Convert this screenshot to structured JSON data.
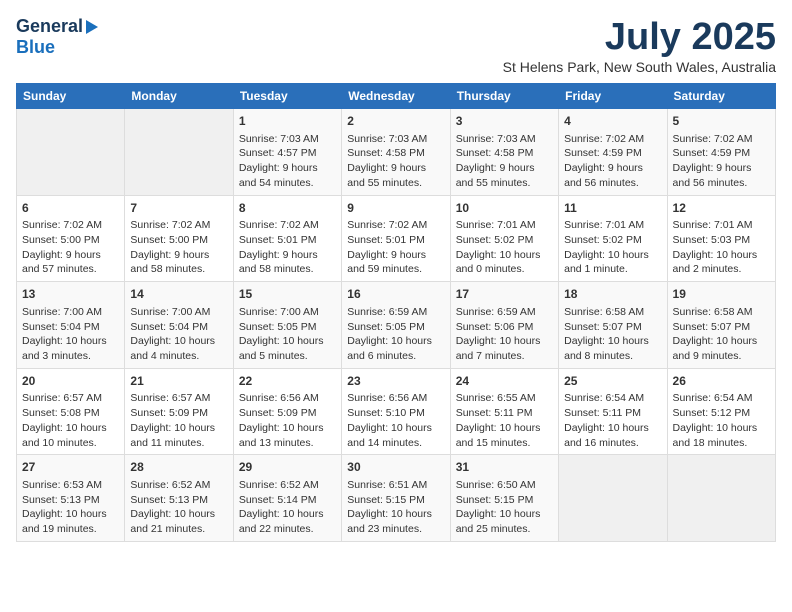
{
  "header": {
    "logo_general": "General",
    "logo_blue": "Blue",
    "title": "July 2025",
    "subtitle": "St Helens Park, New South Wales, Australia"
  },
  "days_of_week": [
    "Sunday",
    "Monday",
    "Tuesday",
    "Wednesday",
    "Thursday",
    "Friday",
    "Saturday"
  ],
  "weeks": [
    [
      {
        "day": "",
        "content": ""
      },
      {
        "day": "",
        "content": ""
      },
      {
        "day": "1",
        "content": "Sunrise: 7:03 AM\nSunset: 4:57 PM\nDaylight: 9 hours and 54 minutes."
      },
      {
        "day": "2",
        "content": "Sunrise: 7:03 AM\nSunset: 4:58 PM\nDaylight: 9 hours and 55 minutes."
      },
      {
        "day": "3",
        "content": "Sunrise: 7:03 AM\nSunset: 4:58 PM\nDaylight: 9 hours and 55 minutes."
      },
      {
        "day": "4",
        "content": "Sunrise: 7:02 AM\nSunset: 4:59 PM\nDaylight: 9 hours and 56 minutes."
      },
      {
        "day": "5",
        "content": "Sunrise: 7:02 AM\nSunset: 4:59 PM\nDaylight: 9 hours and 56 minutes."
      }
    ],
    [
      {
        "day": "6",
        "content": "Sunrise: 7:02 AM\nSunset: 5:00 PM\nDaylight: 9 hours and 57 minutes."
      },
      {
        "day": "7",
        "content": "Sunrise: 7:02 AM\nSunset: 5:00 PM\nDaylight: 9 hours and 58 minutes."
      },
      {
        "day": "8",
        "content": "Sunrise: 7:02 AM\nSunset: 5:01 PM\nDaylight: 9 hours and 58 minutes."
      },
      {
        "day": "9",
        "content": "Sunrise: 7:02 AM\nSunset: 5:01 PM\nDaylight: 9 hours and 59 minutes."
      },
      {
        "day": "10",
        "content": "Sunrise: 7:01 AM\nSunset: 5:02 PM\nDaylight: 10 hours and 0 minutes."
      },
      {
        "day": "11",
        "content": "Sunrise: 7:01 AM\nSunset: 5:02 PM\nDaylight: 10 hours and 1 minute."
      },
      {
        "day": "12",
        "content": "Sunrise: 7:01 AM\nSunset: 5:03 PM\nDaylight: 10 hours and 2 minutes."
      }
    ],
    [
      {
        "day": "13",
        "content": "Sunrise: 7:00 AM\nSunset: 5:04 PM\nDaylight: 10 hours and 3 minutes."
      },
      {
        "day": "14",
        "content": "Sunrise: 7:00 AM\nSunset: 5:04 PM\nDaylight: 10 hours and 4 minutes."
      },
      {
        "day": "15",
        "content": "Sunrise: 7:00 AM\nSunset: 5:05 PM\nDaylight: 10 hours and 5 minutes."
      },
      {
        "day": "16",
        "content": "Sunrise: 6:59 AM\nSunset: 5:05 PM\nDaylight: 10 hours and 6 minutes."
      },
      {
        "day": "17",
        "content": "Sunrise: 6:59 AM\nSunset: 5:06 PM\nDaylight: 10 hours and 7 minutes."
      },
      {
        "day": "18",
        "content": "Sunrise: 6:58 AM\nSunset: 5:07 PM\nDaylight: 10 hours and 8 minutes."
      },
      {
        "day": "19",
        "content": "Sunrise: 6:58 AM\nSunset: 5:07 PM\nDaylight: 10 hours and 9 minutes."
      }
    ],
    [
      {
        "day": "20",
        "content": "Sunrise: 6:57 AM\nSunset: 5:08 PM\nDaylight: 10 hours and 10 minutes."
      },
      {
        "day": "21",
        "content": "Sunrise: 6:57 AM\nSunset: 5:09 PM\nDaylight: 10 hours and 11 minutes."
      },
      {
        "day": "22",
        "content": "Sunrise: 6:56 AM\nSunset: 5:09 PM\nDaylight: 10 hours and 13 minutes."
      },
      {
        "day": "23",
        "content": "Sunrise: 6:56 AM\nSunset: 5:10 PM\nDaylight: 10 hours and 14 minutes."
      },
      {
        "day": "24",
        "content": "Sunrise: 6:55 AM\nSunset: 5:11 PM\nDaylight: 10 hours and 15 minutes."
      },
      {
        "day": "25",
        "content": "Sunrise: 6:54 AM\nSunset: 5:11 PM\nDaylight: 10 hours and 16 minutes."
      },
      {
        "day": "26",
        "content": "Sunrise: 6:54 AM\nSunset: 5:12 PM\nDaylight: 10 hours and 18 minutes."
      }
    ],
    [
      {
        "day": "27",
        "content": "Sunrise: 6:53 AM\nSunset: 5:13 PM\nDaylight: 10 hours and 19 minutes."
      },
      {
        "day": "28",
        "content": "Sunrise: 6:52 AM\nSunset: 5:13 PM\nDaylight: 10 hours and 21 minutes."
      },
      {
        "day": "29",
        "content": "Sunrise: 6:52 AM\nSunset: 5:14 PM\nDaylight: 10 hours and 22 minutes."
      },
      {
        "day": "30",
        "content": "Sunrise: 6:51 AM\nSunset: 5:15 PM\nDaylight: 10 hours and 23 minutes."
      },
      {
        "day": "31",
        "content": "Sunrise: 6:50 AM\nSunset: 5:15 PM\nDaylight: 10 hours and 25 minutes."
      },
      {
        "day": "",
        "content": ""
      },
      {
        "day": "",
        "content": ""
      }
    ]
  ]
}
